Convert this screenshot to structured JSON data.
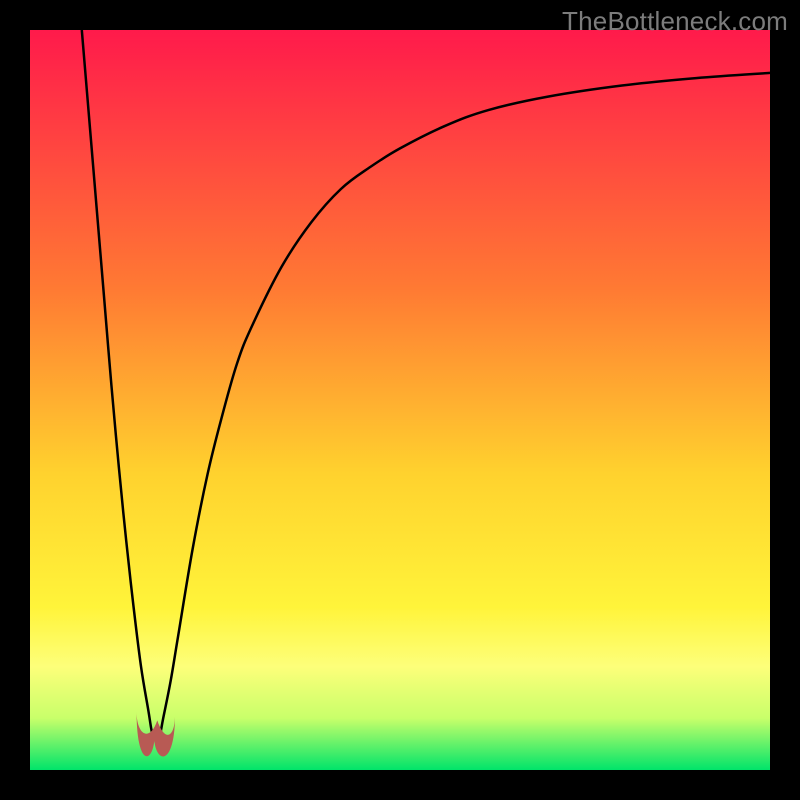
{
  "watermark": "TheBottleneck.com",
  "chart_data": {
    "type": "line",
    "title": "",
    "xlabel": "",
    "ylabel": "",
    "xlim": [
      0,
      100
    ],
    "ylim": [
      0,
      100
    ],
    "grid": false,
    "legend": false,
    "background": {
      "type": "vertical-gradient",
      "stops": [
        {
          "pos": 0.0,
          "color": "#ff1a4b"
        },
        {
          "pos": 0.35,
          "color": "#ff7a33"
        },
        {
          "pos": 0.6,
          "color": "#ffd22e"
        },
        {
          "pos": 0.78,
          "color": "#fff43a"
        },
        {
          "pos": 0.86,
          "color": "#fdff7a"
        },
        {
          "pos": 0.93,
          "color": "#c8ff6a"
        },
        {
          "pos": 1.0,
          "color": "#00e46a"
        }
      ]
    },
    "series": [
      {
        "name": "bottleneck-curve",
        "stroke": "#000000",
        "x": [
          7,
          8,
          9,
          10,
          11,
          12,
          13,
          14,
          15,
          16,
          16.5,
          17,
          17.5,
          18,
          19,
          20,
          22,
          24,
          26,
          28,
          30,
          34,
          38,
          42,
          46,
          50,
          56,
          62,
          70,
          80,
          90,
          100
        ],
        "y": [
          100,
          88,
          76,
          64,
          52,
          41,
          31,
          22,
          14,
          8,
          5,
          4,
          4.5,
          7,
          12,
          18,
          30,
          40,
          48,
          55,
          60,
          68,
          74,
          78.5,
          81.5,
          84,
          87,
          89.2,
          91,
          92.5,
          93.5,
          94.2
        ]
      }
    ],
    "markers": [
      {
        "name": "cusp-blob",
        "shape": "u",
        "fill": "#b85a54",
        "x": 17,
        "y": 3.5,
        "size": 4
      }
    ]
  }
}
